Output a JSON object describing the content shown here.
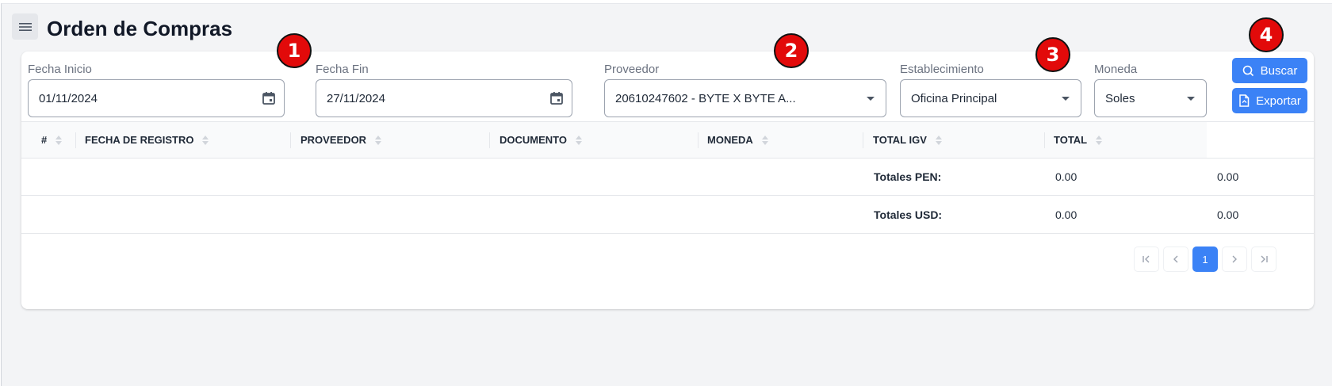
{
  "header": {
    "title": "Orden de Compras"
  },
  "filters": {
    "fecha_inicio": {
      "label": "Fecha Inicio",
      "value": "01/11/2024"
    },
    "fecha_fin": {
      "label": "Fecha Fin",
      "value": "27/11/2024"
    },
    "proveedor": {
      "label": "Proveedor",
      "value": "20610247602 - BYTE X BYTE A..."
    },
    "establecimiento": {
      "label": "Establecimiento",
      "value": "Oficina Principal"
    },
    "moneda": {
      "label": "Moneda",
      "value": "Soles"
    }
  },
  "actions": {
    "buscar": "Buscar",
    "exportar": "Exportar"
  },
  "table": {
    "columns": [
      "#",
      "FECHA DE REGISTRO",
      "PROVEEDOR",
      "DOCUMENTO",
      "MONEDA",
      "TOTAL IGV",
      "TOTAL"
    ],
    "totals": [
      {
        "label": "Totales PEN:",
        "igv": "0.00",
        "total": "0.00"
      },
      {
        "label": "Totales USD:",
        "igv": "0.00",
        "total": "0.00"
      }
    ]
  },
  "pagination": {
    "current_page": "1"
  },
  "markers": [
    "1",
    "2",
    "3",
    "4"
  ],
  "colors": {
    "primary": "#3b82f6",
    "marker": "#e20a0a",
    "background": "#f3f4f6"
  }
}
